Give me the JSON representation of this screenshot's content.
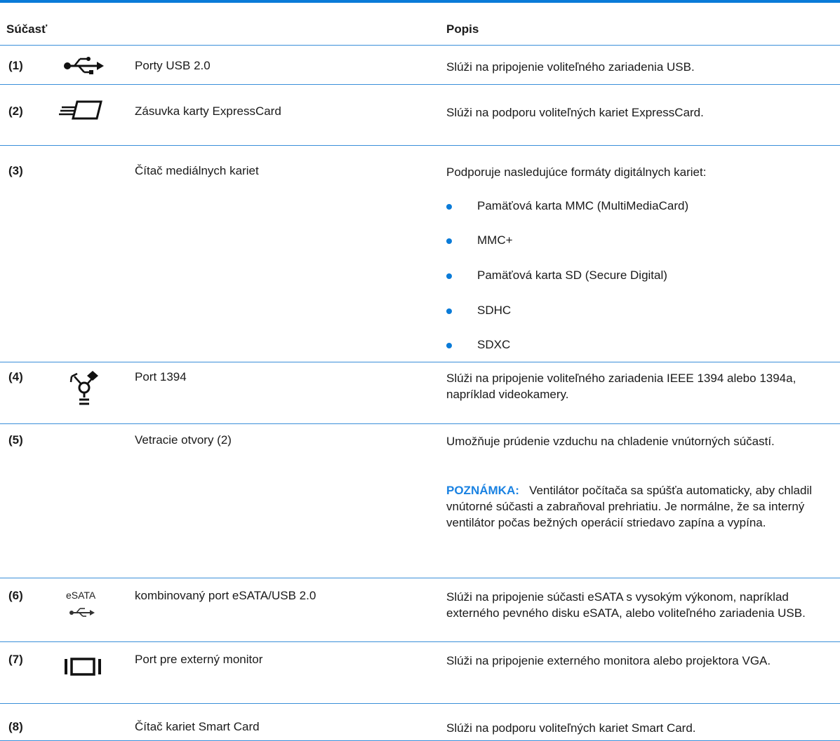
{
  "header": {
    "component": "Súčasť",
    "description": "Popis"
  },
  "rows": [
    {
      "num": "(1)",
      "icon": "usb-icon",
      "component": "Porty USB 2.0",
      "description": "Slúži na pripojenie voliteľného zariadenia USB."
    },
    {
      "num": "(2)",
      "icon": "expresscard-icon",
      "component": "Zásuvka karty ExpressCard",
      "description": "Slúži na podporu voliteľných kariet ExpressCard."
    },
    {
      "num": "(3)",
      "icon": "",
      "component": "Čítač mediálnych kariet",
      "description": "Podporuje nasledujúce formáty digitálnych kariet:",
      "bullets": [
        "Pamäťová karta MMC (MultiMediaCard)",
        "MMC+",
        "Pamäťová karta SD (Secure Digital)",
        "SDHC",
        "SDXC"
      ]
    },
    {
      "num": "(4)",
      "icon": "firewire-icon",
      "component": "Port 1394",
      "description": "Slúži na pripojenie voliteľného zariadenia IEEE 1394 alebo 1394a, napríklad videokamery."
    },
    {
      "num": "(5)",
      "icon": "",
      "component": "Vetracie otvory (2)",
      "description": "Umožňuje prúdenie vzduchu na chladenie vnútorných súčastí.",
      "note_label": "POZNÁMKA:",
      "note_text": "Ventilátor počítača sa spúšťa automaticky, aby chladil vnútorné súčasti a zabraňoval prehriatiu. Je normálne, že sa interný ventilátor počas bežných operácií striedavo zapína a vypína."
    },
    {
      "num": "(6)",
      "icon": "esata-usb-icon",
      "icon_text": "eSATA",
      "component": "kombinovaný port eSATA/USB 2.0",
      "description": "Slúži na pripojenie súčasti eSATA s vysokým výkonom, napríklad externého pevného disku eSATA, alebo voliteľného zariadenia USB."
    },
    {
      "num": "(7)",
      "icon": "external-monitor-icon",
      "component": "Port pre externý monitor",
      "description": "Slúži na pripojenie externého monitora alebo projektora VGA."
    },
    {
      "num": "(8)",
      "icon": "",
      "component": "Čítač kariet Smart Card",
      "description": "Slúži na podporu voliteľných kariet Smart Card."
    }
  ],
  "colors": {
    "rule": "#3a8fd9",
    "accent": "#0a7bd8",
    "note": "#1a82e2"
  }
}
